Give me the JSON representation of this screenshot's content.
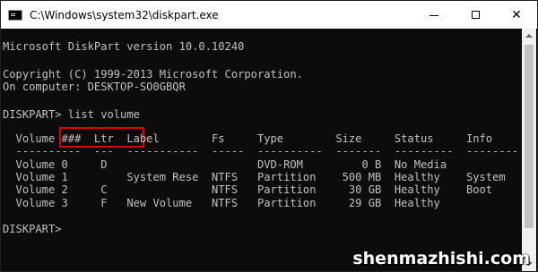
{
  "window": {
    "title": "C:\\Windows\\system32\\diskpart.exe",
    "controls": {
      "minimize": "minimize",
      "maximize": "maximize",
      "close": "✕"
    }
  },
  "console": {
    "lines": [
      "Microsoft DiskPart version 10.0.10240",
      "",
      "Copyright (C) 1999-2013 Microsoft Corporation.",
      "On computer: DESKTOP-SO0GBQR",
      "",
      "DISKPART> list volume",
      "",
      "  Volume ###  Ltr  Label        Fs     Type        Size     Status     Info",
      "  ----------  ---  -----------  -----  ----------  -------  ---------  --------",
      "  Volume 0     D                       DVD-ROM         0 B  No Media",
      "  Volume 1         System Rese  NTFS   Partition    500 MB  Healthy    System",
      "  Volume 2     C                NTFS   Partition     30 GB  Healthy    Boot",
      "  Volume 3     F   New Volume   NTFS   Partition     29 GB  Healthy",
      "",
      "DISKPART>"
    ],
    "highlighted_command": "list volume"
  },
  "watermark": "shenmazhishi.com",
  "colors": {
    "highlight_box": "#e10000",
    "console_text": "#c0c0c0",
    "console_bg": "#0c0c0c"
  }
}
